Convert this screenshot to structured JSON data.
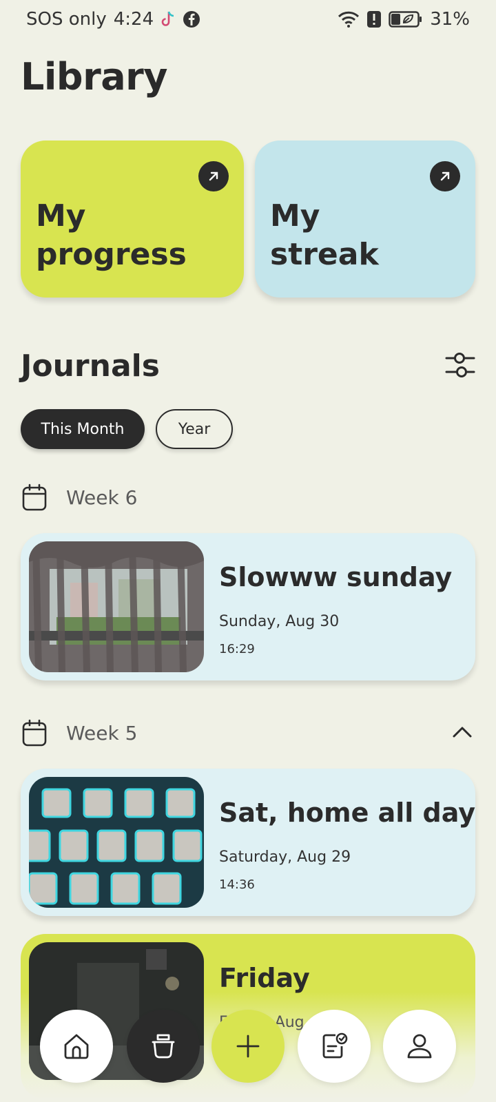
{
  "status_bar": {
    "carrier": "SOS only",
    "time": "4:24",
    "battery": "31%",
    "icons": [
      "tiktok-icon",
      "facebook-icon",
      "wifi-icon",
      "alert-icon",
      "battery-saver-icon"
    ]
  },
  "page_title": "Library",
  "cards": {
    "progress": {
      "label": "My\nprogress",
      "color": "#d8e450"
    },
    "streak": {
      "label": "My\nstreak",
      "color": "#c3e5eb"
    }
  },
  "journals": {
    "title": "Journals",
    "filters": [
      "This Month",
      "Year"
    ],
    "active_filter": "This Month"
  },
  "weeks": [
    {
      "label": "Week 6",
      "entries": [
        {
          "title": "Slowww sunday",
          "date": "Sunday, Aug 30",
          "time": "16:29",
          "thumbnail": "window-curtain-photo"
        }
      ]
    },
    {
      "label": "Week 5",
      "entries": [
        {
          "title": "Sat, home all day",
          "date": "Saturday, Aug 29",
          "time": "14:36",
          "thumbnail": "keyboard-photo"
        },
        {
          "title": "Friday",
          "date": "Friday, Aug",
          "thumbnail": "dark-room-photo"
        }
      ]
    }
  ],
  "bottom_nav": [
    "home-icon",
    "library-icon",
    "add-icon",
    "tasks-icon",
    "profile-icon"
  ],
  "colors": {
    "background": "#f0f1e6",
    "accent": "#d8e450",
    "dark": "#2b2b2b",
    "card_blue": "#dff1f4"
  }
}
